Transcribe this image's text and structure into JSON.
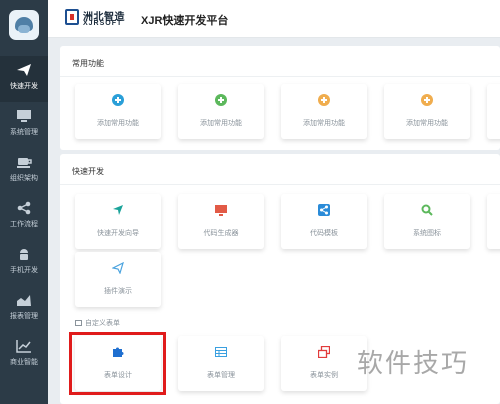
{
  "header": {
    "brand_cn": "洲北智造",
    "brand_en": "XJRSOFT",
    "title": "XJR快速开发平台"
  },
  "sidebar": {
    "items": [
      {
        "label": "快速开发",
        "icon": "paper-plane-icon",
        "active": true
      },
      {
        "label": "系统管理",
        "icon": "monitor-icon"
      },
      {
        "label": "组织架构",
        "icon": "coffee-cup-icon"
      },
      {
        "label": "工作流程",
        "icon": "share-icon"
      },
      {
        "label": "手机开发",
        "icon": "android-icon"
      },
      {
        "label": "报表管理",
        "icon": "area-chart-icon"
      },
      {
        "label": "商业智能",
        "icon": "line-chart-icon"
      }
    ]
  },
  "common": {
    "title": "常用功能",
    "tiles": [
      {
        "label": "添加常用功能",
        "icon": "plus-circle-icon",
        "color": "#2a9fd8"
      },
      {
        "label": "添加常用功能",
        "icon": "plus-circle-icon",
        "color": "#5cb85c"
      },
      {
        "label": "添加常用功能",
        "icon": "plus-circle-icon",
        "color": "#f0ad4e"
      },
      {
        "label": "添加常用功能",
        "icon": "plus-circle-icon",
        "color": "#f0ad4e"
      }
    ]
  },
  "quick": {
    "title": "快速开发",
    "tiles": [
      {
        "label": "快速开发向导",
        "icon": "send-icon",
        "color": "#1aa39a"
      },
      {
        "label": "代码生成器",
        "icon": "monitor-icon",
        "color": "#e25a46"
      },
      {
        "label": "代码模板",
        "icon": "share-icon",
        "color": "#2a8bd8"
      },
      {
        "label": "系统图标",
        "icon": "search-icon",
        "color": "#5cb85c"
      },
      {
        "label": "插件演示",
        "icon": "paper-plane-icon",
        "color": "#4aa3df"
      }
    ],
    "custom_form_header": "自定义表单",
    "form_tiles": [
      {
        "label": "表单设计",
        "icon": "puzzle-icon",
        "color": "#1f6fd0"
      },
      {
        "label": "表单管理",
        "icon": "table-icon",
        "color": "#3aa0e0"
      },
      {
        "label": "表单实例",
        "icon": "copy-icon",
        "color": "#e23b3b"
      }
    ]
  },
  "watermark": "软件技巧"
}
